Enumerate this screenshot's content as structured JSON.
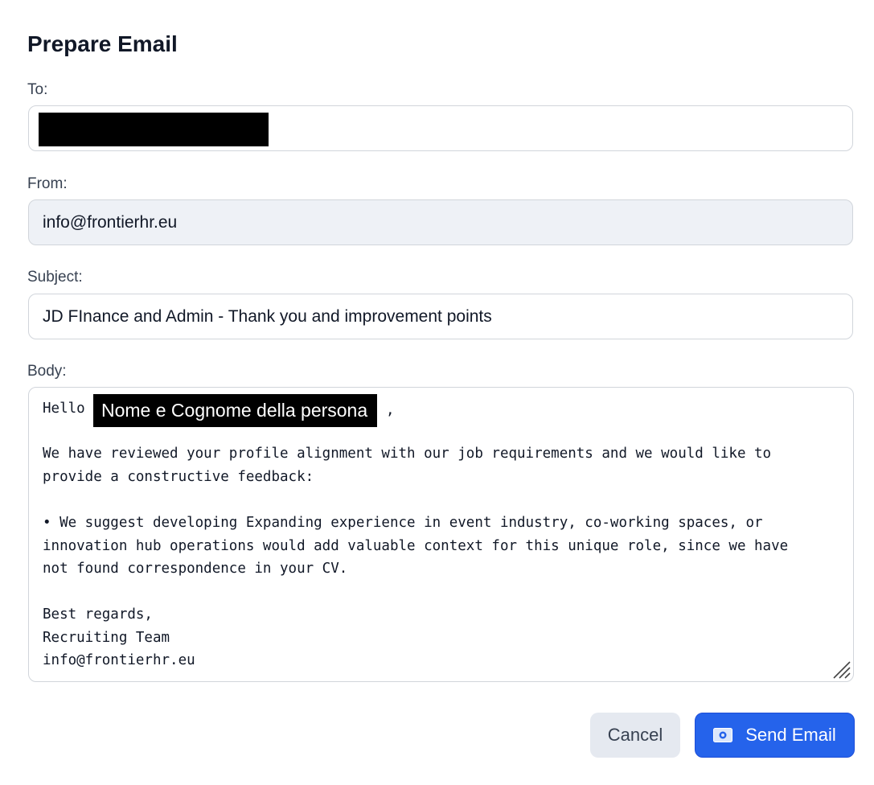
{
  "dialog": {
    "title": "Prepare Email"
  },
  "form": {
    "to_label": "To:",
    "to_value": "",
    "from_label": "From:",
    "from_value": "info@frontierhr.eu",
    "subject_label": "Subject:",
    "subject_value": "JD FInance and Admin - Thank you and improvement points",
    "body_label": "Body:",
    "body": {
      "greeting": "Hello",
      "recipient_name": "Nome e Cognome della persona",
      "greeting_suffix": ",",
      "lines": [
        "We have reviewed your profile alignment with our job requirements and we would like to",
        "provide a constructive feedback:",
        "",
        "• We suggest developing Expanding experience in event industry, co-working spaces, or",
        "innovation hub operations would add valuable context for this unique role, since we have",
        "not found correspondence in your CV.",
        "",
        "Best regards,",
        "Recruiting Team",
        "info@frontierhr.eu"
      ]
    }
  },
  "actions": {
    "cancel_label": "Cancel",
    "send_label": "Send Email",
    "send_icon": "envelope-icon"
  },
  "colors": {
    "primary": "#2563eb",
    "readonly_bg": "#eef1f6",
    "secondary_bg": "#e5e9f0"
  }
}
